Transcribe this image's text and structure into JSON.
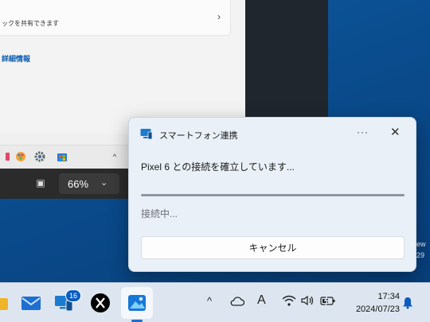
{
  "settings": {
    "card_text": "ックを共有できます",
    "chevron": "›",
    "link": "詳細情報"
  },
  "app_toolbar": {
    "screen_icon": "▣",
    "zoom_value": "66%",
    "dropdown_chevron": "⌄"
  },
  "desktop_fragments": {
    "ew": "ew",
    "num": "29"
  },
  "dialog": {
    "title": "スマートフォン連携",
    "more": "···",
    "close": "✕",
    "message": "Pixel 6 との接続を確立しています...",
    "progress": 1.0,
    "status": "接続中...",
    "cancel": "キャンセル"
  },
  "taskbar": {
    "badge_count": "16",
    "tray": {
      "chevron": "^",
      "ime": "A"
    },
    "clock": {
      "time": "17:34",
      "date": "2024/07/23"
    }
  },
  "colors": {
    "accent": "#1e6fd0",
    "desktop": "#0b4f8a"
  }
}
